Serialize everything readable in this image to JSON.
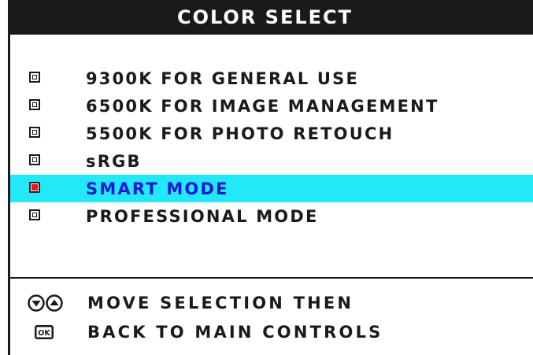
{
  "title": "COLOR SELECT",
  "menu": {
    "items": [
      {
        "label": "9300K FOR GENERAL USE",
        "selected": false
      },
      {
        "label": "6500K FOR IMAGE MANAGEMENT",
        "selected": false
      },
      {
        "label": "5500K FOR PHOTO RETOUCH",
        "selected": false
      },
      {
        "label": "sRGB",
        "selected": false
      },
      {
        "label": "SMART MODE",
        "selected": true
      },
      {
        "label": "PROFESSIONAL MODE",
        "selected": false
      }
    ]
  },
  "hints": {
    "line1": "MOVE SELECTION THEN",
    "line2": "BACK TO MAIN CONTROLS",
    "ok_key": "OK"
  },
  "colors": {
    "highlight": "#22e8f8",
    "selected_text": "#1818d8",
    "selected_marker": "#e41515",
    "text": "#1a1a1a"
  },
  "icons": {
    "unselected": "checkbox-empty-icon",
    "selected": "checkbox-selected-icon",
    "down": "down-arrow-button-icon",
    "up": "up-arrow-button-icon",
    "ok": "ok-button-icon"
  }
}
